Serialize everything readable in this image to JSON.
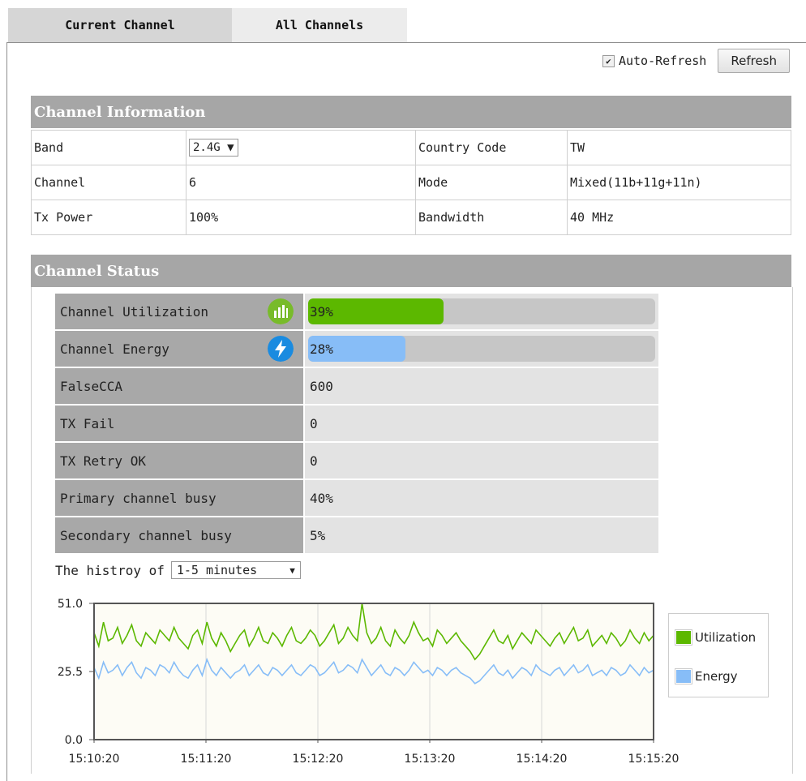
{
  "tabs": {
    "current": "Current Channel",
    "all": "All Channels"
  },
  "toolbar": {
    "auto_refresh_label": "Auto-Refresh",
    "auto_refresh_checked": true,
    "refresh_button": "Refresh"
  },
  "channel_info": {
    "title": "Channel Information",
    "rows": [
      {
        "k1": "Band",
        "v1": "2.4G",
        "k2": "Country Code",
        "v2": "TW"
      },
      {
        "k1": "Channel",
        "v1": "6",
        "k2": "Mode",
        "v2": "Mixed(11b+11g+11n)"
      },
      {
        "k1": "Tx Power",
        "v1": "100%",
        "k2": "Bandwidth",
        "v2": "40 MHz"
      }
    ]
  },
  "channel_status": {
    "title": "Channel Status",
    "utilization": {
      "label": "Channel Utilization",
      "value": "39%",
      "percent": 39,
      "color": "#5cb800",
      "icon": "bar-chart-icon"
    },
    "energy": {
      "label": "Channel Energy",
      "value": "28%",
      "percent": 28,
      "color": "#87bdf7",
      "icon": "lightning-icon"
    },
    "rows": [
      {
        "label": "FalseCCA",
        "value": "600"
      },
      {
        "label": "TX Fail",
        "value": "0"
      },
      {
        "label": "TX Retry OK",
        "value": "0"
      },
      {
        "label": "Primary channel busy",
        "value": "40%"
      },
      {
        "label": "Secondary channel busy",
        "value": "5%"
      }
    ]
  },
  "history": {
    "label": "The histroy of",
    "selected": "1-5 minutes"
  },
  "chart_data": {
    "type": "line",
    "x": [
      "15:10:20",
      "15:11:20",
      "15:12:20",
      "15:13:20",
      "15:14:20",
      "15:15:20"
    ],
    "yticks": [
      "0.0",
      "25.5",
      "51.0"
    ],
    "ylim": [
      0,
      51
    ],
    "legend_position": "right",
    "series": [
      {
        "name": "Utilization",
        "color": "#5cb800",
        "values": [
          40,
          35,
          44,
          37,
          38,
          42,
          36,
          39,
          43,
          37,
          35,
          40,
          38,
          36,
          41,
          39,
          37,
          42,
          38,
          36,
          34,
          39,
          41,
          36,
          44,
          38,
          35,
          40,
          37,
          33,
          36,
          39,
          41,
          35,
          38,
          42,
          37,
          36,
          40,
          38,
          35,
          39,
          42,
          37,
          36,
          38,
          41,
          39,
          35,
          37,
          40,
          43,
          36,
          38,
          42,
          39,
          37,
          51,
          40,
          36,
          38,
          42,
          37,
          35,
          41,
          38,
          36,
          39,
          44,
          40,
          37,
          38,
          35,
          41,
          39,
          36,
          38,
          40,
          37,
          35,
          33,
          30,
          32,
          35,
          38,
          41,
          37,
          36,
          39,
          34,
          37,
          40,
          38,
          36,
          41,
          39,
          37,
          35,
          38,
          40,
          36,
          39,
          42,
          37,
          38,
          41,
          35,
          37,
          39,
          36,
          40,
          38,
          35,
          37,
          41,
          38,
          36,
          40,
          37,
          39
        ]
      },
      {
        "name": "Energy",
        "color": "#87bdf7",
        "values": [
          27,
          23,
          29,
          25,
          26,
          28,
          24,
          27,
          29,
          25,
          23,
          27,
          26,
          24,
          28,
          27,
          25,
          29,
          26,
          24,
          23,
          26,
          28,
          24,
          30,
          26,
          24,
          27,
          25,
          23,
          25,
          26,
          28,
          24,
          26,
          28,
          25,
          24,
          27,
          26,
          24,
          26,
          28,
          25,
          24,
          26,
          28,
          27,
          24,
          25,
          27,
          29,
          25,
          26,
          28,
          27,
          25,
          30,
          27,
          24,
          26,
          28,
          25,
          24,
          27,
          26,
          24,
          26,
          29,
          27,
          25,
          26,
          24,
          27,
          26,
          24,
          26,
          27,
          25,
          24,
          23,
          21,
          22,
          24,
          26,
          28,
          25,
          24,
          26,
          23,
          25,
          27,
          26,
          24,
          28,
          26,
          25,
          24,
          26,
          27,
          24,
          26,
          28,
          25,
          26,
          28,
          24,
          25,
          26,
          24,
          27,
          26,
          24,
          25,
          28,
          26,
          24,
          27,
          25,
          26
        ]
      }
    ]
  }
}
